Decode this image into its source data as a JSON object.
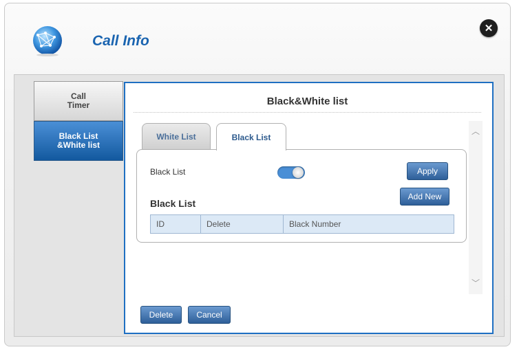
{
  "header": {
    "title": "Call Info",
    "logo_icon": "globe-network-icon",
    "close_icon": "close-icon",
    "close_glyph": "✕"
  },
  "sidebar": {
    "items": [
      {
        "label": "Call\nTimer",
        "active": false
      },
      {
        "label": "Black List\n&White list",
        "active": true
      }
    ]
  },
  "panel": {
    "heading": "Black&White list",
    "tabs": [
      {
        "label": "White List",
        "active": false
      },
      {
        "label": "Black List",
        "active": true
      }
    ],
    "blacklist": {
      "toggle_label": "Black List",
      "toggle_on": true,
      "apply_label": "Apply",
      "add_new_label": "Add New",
      "list_heading": "Black List",
      "columns": [
        "ID",
        "Delete",
        "Black Number"
      ],
      "rows": []
    },
    "scroll": {
      "up_glyph": "︿",
      "down_glyph": "﹀"
    },
    "footer": {
      "delete_label": "Delete",
      "cancel_label": "Cancel"
    }
  },
  "colors": {
    "accent": "#1e6fc2",
    "title": "#1a64b0",
    "button_top": "#6b9ad0",
    "button_bottom": "#2e5f99"
  }
}
